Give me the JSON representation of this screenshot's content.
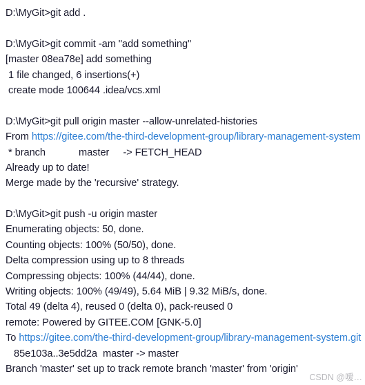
{
  "terminal": {
    "prompt": "D:\\MyGit>",
    "link_color": "#2e7fd4",
    "text_color": "#1a1a2e",
    "background_color": "#ffffff",
    "blocks": [
      {
        "name": "git-add-block",
        "command_line": "D:\\MyGit>git add .",
        "output_lines": []
      },
      {
        "name": "git-commit-block",
        "command_line": "D:\\MyGit>git commit -am \"add something\"",
        "output_lines": [
          "[master 08ea78e] add something",
          " 1 file changed, 6 insertions(+)",
          " create mode 100644 .idea/vcs.xml"
        ]
      },
      {
        "name": "git-pull-block",
        "command_line": "D:\\MyGit>git pull origin master --allow-unrelated-histories",
        "from_prefix": "From ",
        "from_url": "https://gitee.com/the-third-development-group/library-management-system",
        "output_lines": [
          " * branch            master     -> FETCH_HEAD",
          "Already up to date!",
          "Merge made by the 'recursive' strategy."
        ]
      },
      {
        "name": "git-push-block",
        "command_line": "D:\\MyGit>git push -u origin master",
        "output_lines_before_url": [
          "Enumerating objects: 50, done.",
          "Counting objects: 100% (50/50), done.",
          "Delta compression using up to 8 threads",
          "Compressing objects: 100% (44/44), done.",
          "Writing objects: 100% (49/49), 5.64 MiB | 9.32 MiB/s, done.",
          "Total 49 (delta 4), reused 0 (delta 0), pack-reused 0",
          "remote: Powered by GITEE.COM [GNK-5.0]"
        ],
        "to_prefix": "To ",
        "to_url": "https://gitee.com/the-third-development-group/library-management-system.git",
        "output_lines_after_url": [
          "   85e103a..3e5dd2a  master -> master",
          "Branch 'master' set up to track remote branch 'master' from 'origin'"
        ]
      }
    ]
  },
  "watermark": {
    "text": "CSDN @嗳…"
  }
}
